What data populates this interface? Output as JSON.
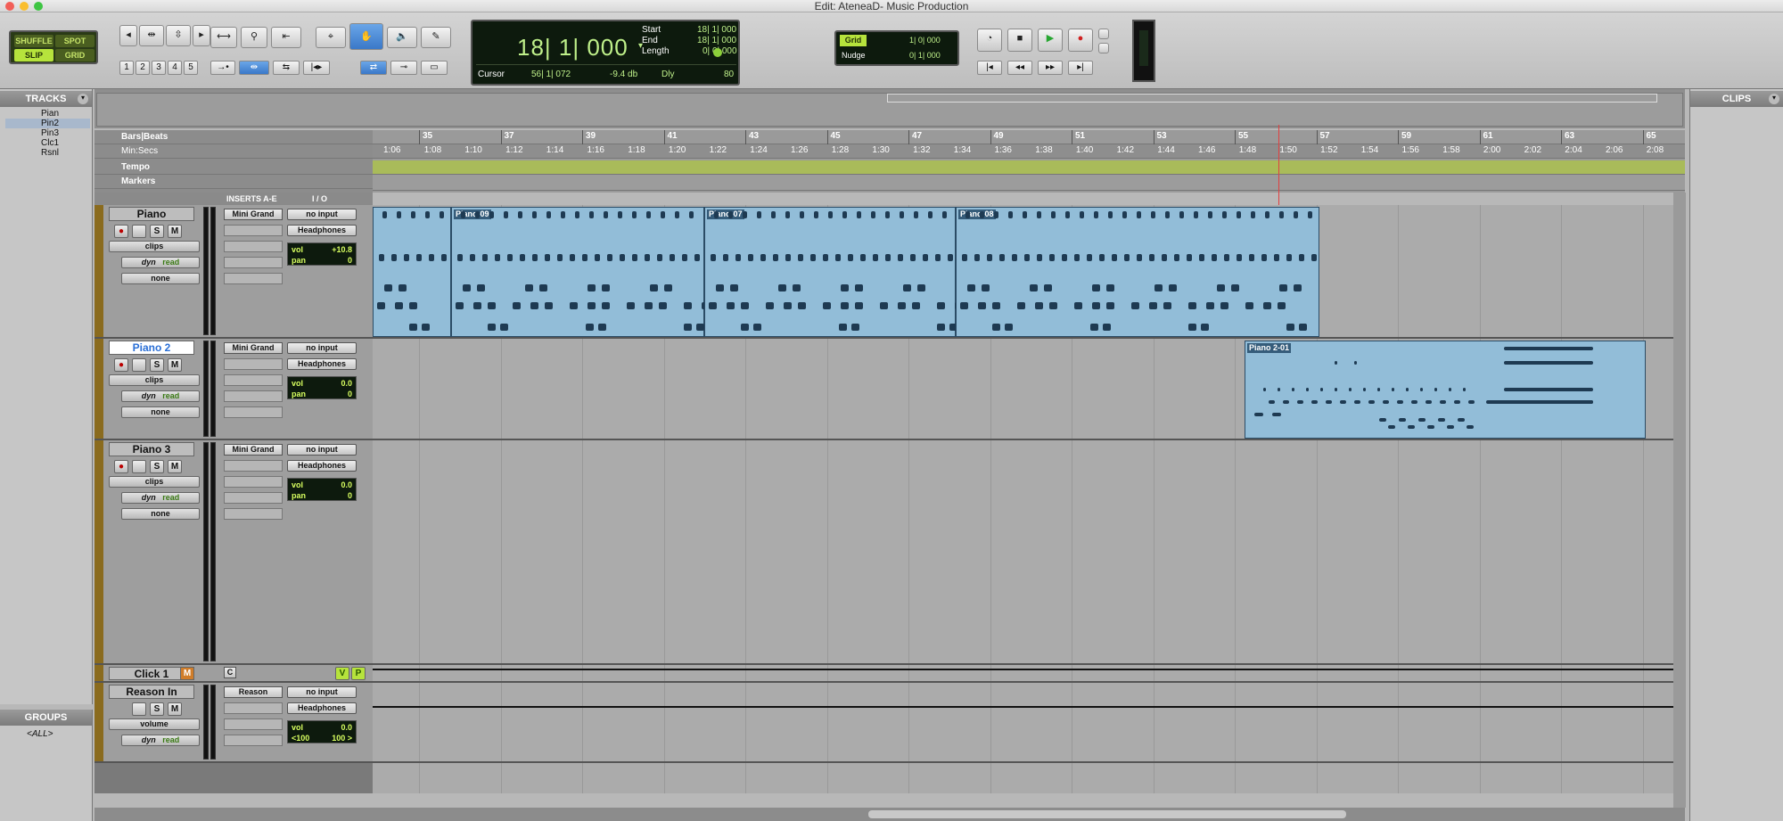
{
  "window": {
    "title": "Edit: AteneaD- Music Production"
  },
  "modes": {
    "shuffle": "SHUFFLE",
    "spot": "SPOT",
    "slip": "SLIP",
    "grid": "GRID"
  },
  "zoom_presets": [
    "1",
    "2",
    "3",
    "4",
    "5"
  ],
  "counter": {
    "main": "18| 1| 000",
    "start_label": "Start",
    "start": "18| 1| 000",
    "end_label": "End",
    "end": "18| 1| 000",
    "length_label": "Length",
    "length": "0| 0| 000",
    "cursor_label": "Cursor",
    "cursor": "56| 1| 072",
    "cursor_db": "-9.4 db",
    "dly": "Dly",
    "value_80": "80"
  },
  "grid_nudge": {
    "grid_label": "Grid",
    "grid_value": "1| 0| 000",
    "nudge_label": "Nudge",
    "nudge_value": "0| 1| 000"
  },
  "panels": {
    "tracks": "TRACKS",
    "groups": "GROUPS",
    "clips": "CLIPS"
  },
  "track_list": [
    "Pian",
    "Pin2",
    "Pin3",
    "Clc1",
    "Rsnl"
  ],
  "groups_list": [
    "<ALL>"
  ],
  "ruler": {
    "bars_label": "Bars|Beats",
    "min_label": "Min:Secs",
    "tempo_label": "Tempo",
    "markers_label": "Markers",
    "bars": [
      "35",
      "37",
      "39",
      "41",
      "43",
      "45",
      "47",
      "49",
      "51",
      "53",
      "55",
      "57",
      "59",
      "61",
      "63",
      "65"
    ],
    "mins": [
      "1:06",
      "1:08",
      "1:10",
      "1:12",
      "1:14",
      "1:16",
      "1:18",
      "1:20",
      "1:22",
      "1:24",
      "1:26",
      "1:28",
      "1:30",
      "1:32",
      "1:34",
      "1:36",
      "1:38",
      "1:40",
      "1:42",
      "1:44",
      "1:46",
      "1:48",
      "1:50",
      "1:52",
      "1:54",
      "1:56",
      "1:58",
      "2:00",
      "2:02",
      "2:04",
      "2:06",
      "2:08"
    ]
  },
  "mix_header": {
    "inserts": "INSERTS A-E",
    "io": "I / O"
  },
  "tracks": [
    {
      "name": "Piano",
      "insert": "Mini Grand",
      "input": "no input",
      "output": "Headphones",
      "vol": "+10.8",
      "pan": "0",
      "clips": "clips",
      "dyn": "dyn",
      "read": "read",
      "none": "none"
    },
    {
      "name": "Piano 2",
      "insert": "Mini Grand",
      "input": "no input",
      "output": "Headphones",
      "vol": "0.0",
      "pan": "0",
      "clips": "clips",
      "dyn": "dyn",
      "read": "read",
      "none": "none"
    },
    {
      "name": "Piano 3",
      "insert": "Mini Grand",
      "input": "no input",
      "output": "Headphones",
      "vol": "0.0",
      "pan": "0",
      "clips": "clips",
      "dyn": "dyn",
      "read": "read",
      "none": "none"
    },
    {
      "name": "Click 1",
      "insert": "C"
    },
    {
      "name": "Reason In",
      "insert": "Reason",
      "input": "no input",
      "output": "Headphones",
      "vol": "0.0",
      "pan_l": "<100",
      "pan_r": "100 >",
      "volume": "volume",
      "dyn": "dyn",
      "read": "read"
    }
  ],
  "vol_label": "vol",
  "pan_label": "pan",
  "clips": [
    "Piano-09",
    "Piano-07",
    "Piano-08",
    "Piano 2-01"
  ],
  "colors": {
    "clip": "#92bdd8",
    "track_color": "#8a6b1e",
    "lcd_text": "#bff08a"
  }
}
